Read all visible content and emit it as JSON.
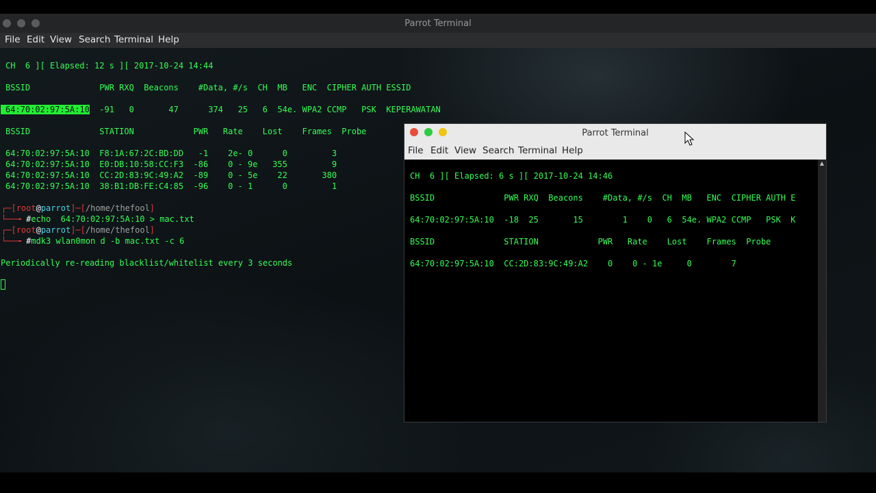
{
  "main_window": {
    "title": "Parrot Terminal",
    "menu": [
      "File",
      "Edit",
      "View",
      "Search",
      "Terminal",
      "Help"
    ],
    "terminal": {
      "status_line": "CH  6 ][ Elapsed: 12 s ][ 2017-10-24 14:44",
      "ap_header": "BSSID              PWR RXQ  Beacons    #Data, #/s  CH  MB   ENC  CIPHER AUTH ESSID",
      "ap_row_bssid": "64:70:02:97:5A:10",
      "ap_row_rest": "  -91   0       47      374   25   6  54e. WPA2 CCMP   PSK  KEPERAWATAN",
      "station_header": "BSSID              STATION            PWR   Rate    Lost    Frames  Probe",
      "stations": [
        "64:70:02:97:5A:10  F8:1A:67:2C:BD:DD   -1    2e- 0      0         3",
        "64:70:02:97:5A:10  E0:DB:10:58:CC:F3  -86    0 - 9e   355         9",
        "64:70:02:97:5A:10  CC:2D:83:9C:49:A2  -89    0 - 5e    22       380",
        "64:70:02:97:5A:10  38:B1:DB:FE:C4:85  -96    0 - 1      0         1"
      ],
      "prompt_user": "root",
      "prompt_at": "@",
      "prompt_host": "parrot",
      "prompt_path": "/home/thefool",
      "cmd1": "echo  64:70:02:97:5A:10 > mac.txt",
      "cmd2": "mdk3 wlan0mon d -b mac.txt -c 6",
      "output": "Periodically re-reading blacklist/whitelist every 3 seconds"
    }
  },
  "second_window": {
    "title": "Parrot Terminal",
    "menu": [
      "File",
      "Edit",
      "View",
      "Search",
      "Terminal",
      "Help"
    ],
    "terminal": {
      "status_line": "CH  6 ][ Elapsed: 6 s ][ 2017-10-24 14:46",
      "ap_header": "BSSID              PWR RXQ  Beacons    #Data, #/s  CH  MB   ENC  CIPHER AUTH E",
      "ap_row": "64:70:02:97:5A:10  -18  25       15        1    0   6  54e. WPA2 CCMP   PSK  K",
      "station_header": "BSSID              STATION            PWR   Rate    Lost    Frames  Probe",
      "station_row": "64:70:02:97:5A:10  CC:2D:83:9C:49:A2    0    0 - 1e     0        7"
    }
  },
  "colors": {
    "terminal_green": "#33ff55",
    "prompt_red": "#e03a3a",
    "host_cyan": "#44d3e8",
    "close": "#e74c3c",
    "minimize": "#2ecc40",
    "maximize": "#f1c40f"
  }
}
